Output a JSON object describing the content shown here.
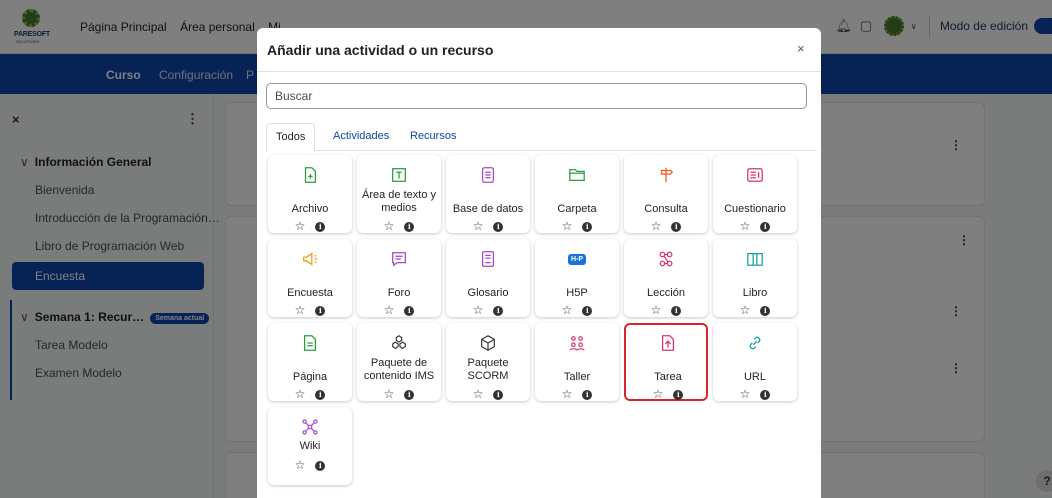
{
  "topbar": {
    "logo_text": "PARESOFT",
    "logo_sub": "SOLUTIONS",
    "nav": [
      "Página Principal",
      "Área personal",
      "Mi"
    ],
    "edit_mode_label": "Modo de edición"
  },
  "course_nav": {
    "items": [
      "Curso",
      "Configuración",
      "P"
    ]
  },
  "drawer": {
    "close": "×",
    "section1_title": "Información General",
    "section1_items": [
      "Bienvenida",
      "Introducción de la Programación…",
      "Libro de Programación Web"
    ],
    "active_item": "Encuesta",
    "section2_title": "Semana 1: Recur…",
    "section2_badge": "Semana actual",
    "section2_items": [
      "Tarea Modelo",
      "Examen Modelo"
    ]
  },
  "help": "?",
  "modal": {
    "title": "Añadir una actividad o un recurso",
    "close": "×",
    "search_placeholder": "Buscar",
    "tabs": [
      "Todos",
      "Actividades",
      "Recursos"
    ],
    "tiles": [
      {
        "label": "Archivo",
        "icon": "file-plus-icon",
        "color": "#2a9d3f"
      },
      {
        "label": "Área de texto y medios",
        "icon": "text-media-icon",
        "color": "#2a9d3f"
      },
      {
        "label": "Base de datos",
        "icon": "database-icon",
        "color": "#a646c8"
      },
      {
        "label": "Carpeta",
        "icon": "folder-icon",
        "color": "#2a9d3f"
      },
      {
        "label": "Consulta",
        "icon": "signpost-icon",
        "color": "#f05a28"
      },
      {
        "label": "Cuestionario",
        "icon": "quiz-icon",
        "color": "#d8336f"
      },
      {
        "label": "Encuesta",
        "icon": "megaphone-icon",
        "color": "#e9a017"
      },
      {
        "label": "Foro",
        "icon": "chat-icon",
        "color": "#a646c8"
      },
      {
        "label": "Glosario",
        "icon": "glossary-icon",
        "color": "#a646c8"
      },
      {
        "label": "H5P",
        "icon": "h5p-icon",
        "color": "#1a73d9",
        "badge": "H-P"
      },
      {
        "label": "Lección",
        "icon": "lesson-icon",
        "color": "#d8336f"
      },
      {
        "label": "Libro",
        "icon": "book-icon",
        "color": "#17a2a2"
      },
      {
        "label": "Página",
        "icon": "page-icon",
        "color": "#2a9d3f"
      },
      {
        "label": "Paquete de contenido IMS",
        "icon": "ims-package-icon",
        "color": "#333333"
      },
      {
        "label": "Paquete SCORM",
        "icon": "scorm-package-icon",
        "color": "#333333"
      },
      {
        "label": "Taller",
        "icon": "workshop-icon",
        "color": "#d8336f"
      },
      {
        "label": "Tarea",
        "icon": "assignment-icon",
        "color": "#d8336f"
      },
      {
        "label": "URL",
        "icon": "link-icon",
        "color": "#17a2a2"
      },
      {
        "label": "Wiki",
        "icon": "wiki-icon",
        "color": "#a646c8"
      }
    ],
    "selected_tile": "Tarea"
  }
}
